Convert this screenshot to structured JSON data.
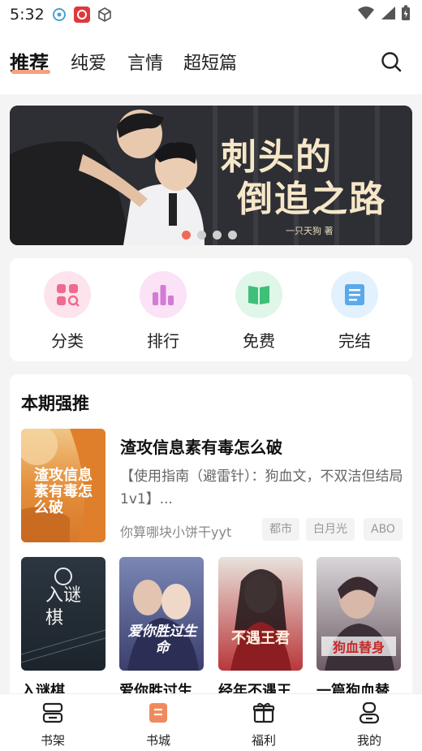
{
  "status": {
    "time": "5:32"
  },
  "tabs": [
    {
      "label": "推荐",
      "active": true
    },
    {
      "label": "纯爱"
    },
    {
      "label": "言情"
    },
    {
      "label": "超短篇"
    }
  ],
  "banner": {
    "title_line1": "刺头的",
    "title_line2": "倒追之路",
    "author": "一只天狗 著"
  },
  "categories": [
    {
      "label": "分类",
      "icon": "category-icon",
      "bg": "#fde4ec",
      "color": "#f06a8f"
    },
    {
      "label": "排行",
      "icon": "ranking-icon",
      "bg": "#fbe2f6",
      "color": "#d37bd6"
    },
    {
      "label": "免费",
      "icon": "book-open-icon",
      "bg": "#dff6e8",
      "color": "#3fbf7a"
    },
    {
      "label": "完结",
      "icon": "finished-icon",
      "bg": "#e2f1fd",
      "color": "#5aa9ea"
    }
  ],
  "featured": {
    "section_title": "本期强推",
    "main_book": {
      "title": "渣攻信息素有毒怎么破",
      "description": "【使用指南（避雷针）：狗血文，不双洁但结局1v1】...",
      "author": "你算哪块小饼干yyt",
      "tags": [
        "都市",
        "白月光",
        "ABO"
      ],
      "cover_text": "渣攻信息素有毒怎么破"
    },
    "books": [
      {
        "title": "入谜棋",
        "cover_text": "入谜棋"
      },
      {
        "title": "爱你胜过生",
        "cover_text": "爱你胜过生命"
      },
      {
        "title": "经年不遇王",
        "cover_text": "不遇王君"
      },
      {
        "title": "一篇狗血替",
        "cover_text": "狗血替身"
      }
    ]
  },
  "bottom_nav": [
    {
      "label": "书架",
      "icon": "bookshelf-icon"
    },
    {
      "label": "书城",
      "icon": "bookstore-icon",
      "active": true,
      "color": "#f08a5d"
    },
    {
      "label": "福利",
      "icon": "gift-icon"
    },
    {
      "label": "我的",
      "icon": "profile-icon"
    }
  ]
}
